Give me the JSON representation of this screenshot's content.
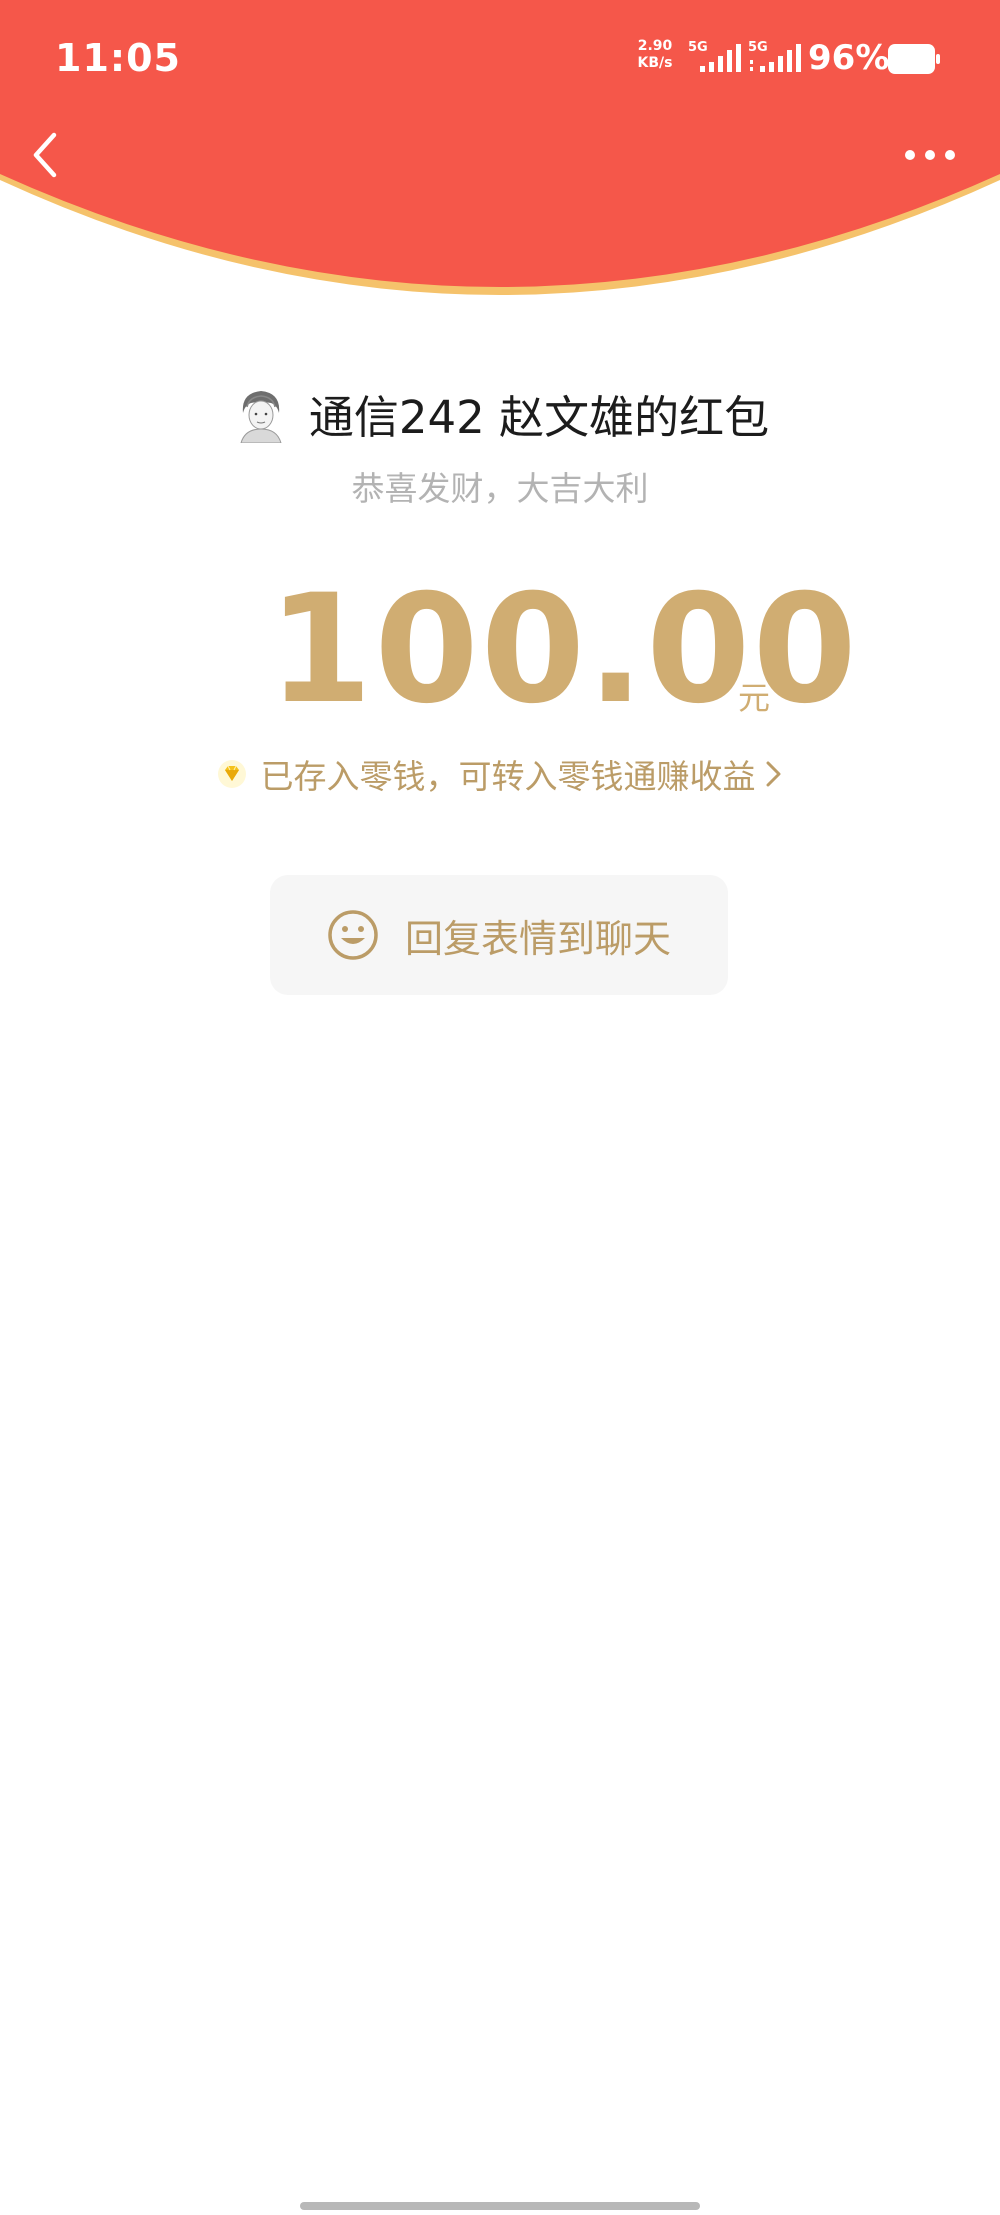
{
  "status_bar": {
    "time": "11:05",
    "net_speed_value": "2.90",
    "net_speed_unit": "KB/s",
    "sim1_label": "5G",
    "sim2_label": "5G",
    "battery_percent": "96%"
  },
  "header": {
    "back_icon": "chevron-left-icon",
    "more_icon": "more-dots-icon",
    "background_color": "#f5574a",
    "curve_edge_color": "#f5c26b"
  },
  "red_packet": {
    "sender_name": "通信242 赵文雄的红包",
    "greeting": "恭喜发财，大吉大利",
    "amount": "100.00",
    "unit": "元",
    "deposit_note": "已存入零钱，可转入零钱通赚收益",
    "deposit_icon": "diamond-icon",
    "accent_color": "#d0ad72"
  },
  "reply_button": {
    "label": "回复表情到聊天",
    "icon": "smile-icon"
  }
}
